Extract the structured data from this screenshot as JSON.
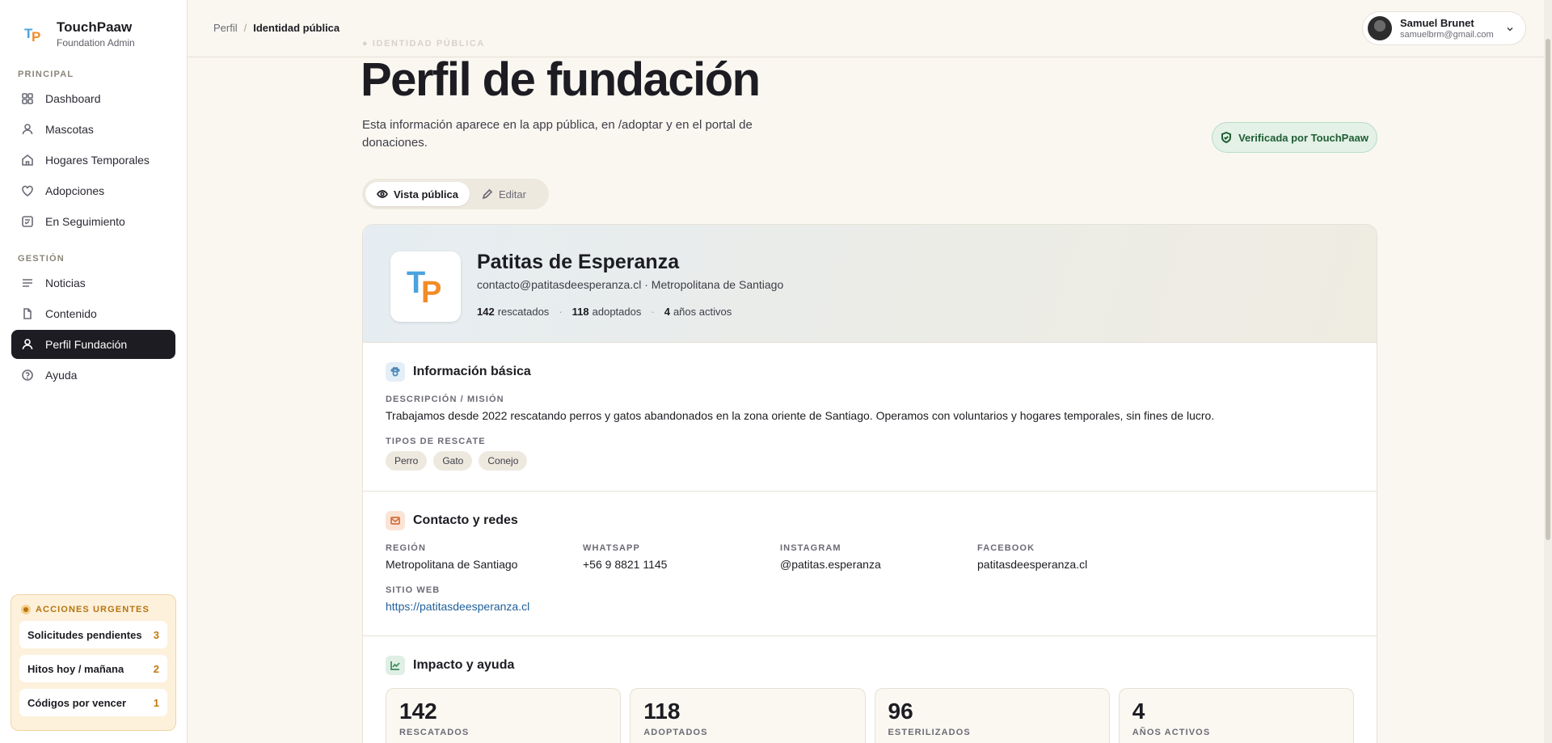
{
  "brand": {
    "name": "TouchPaaw",
    "role": "Foundation Admin"
  },
  "sidebar": {
    "principal_label": "PRINCIPAL",
    "principal_items": [
      {
        "label": "Dashboard",
        "icon": "grid-icon"
      },
      {
        "label": "Mascotas",
        "icon": "user-icon"
      },
      {
        "label": "Hogares Temporales",
        "icon": "home-icon"
      },
      {
        "label": "Adopciones",
        "icon": "heart-icon"
      },
      {
        "label": "En Seguimiento",
        "icon": "checklist-icon"
      }
    ],
    "gestion_label": "GESTIÓN",
    "gestion_items": [
      {
        "label": "Noticias",
        "icon": "lines-icon"
      },
      {
        "label": "Contenido",
        "icon": "file-icon"
      },
      {
        "label": "Perfil Fundación",
        "icon": "user-icon",
        "active": true
      },
      {
        "label": "Ayuda",
        "icon": "help-icon"
      }
    ],
    "urgent": {
      "title": "ACCIONES URGENTES",
      "rows": [
        {
          "label": "Solicitudes pendientes",
          "count": "3"
        },
        {
          "label": "Hitos hoy / mañana",
          "count": "2"
        },
        {
          "label": "Códigos por vencer",
          "count": "1"
        }
      ]
    }
  },
  "header": {
    "breadcrumb": {
      "parent": "Perfil",
      "sep": "/",
      "current": "Identidad pública"
    },
    "user": {
      "name": "Samuel Brunet",
      "email": "samuelbrm@gmail.com"
    }
  },
  "page": {
    "eyebrow": "● IDENTIDAD PÚBLICA",
    "title": "Perfil de fundación",
    "description": "Esta información aparece en la app pública, en /adoptar y en el portal de donaciones.",
    "verified_badge": "Verificada por TouchPaaw",
    "view_toggle": {
      "public": "Vista pública",
      "edit": "Editar"
    }
  },
  "profile": {
    "name": "Patitas de Esperanza",
    "email": "contacto@patitasdeesperanza.cl",
    "dot": "·",
    "region": "Metropolitana de Santiago",
    "stats": [
      {
        "value": "142",
        "label": "rescatados"
      },
      {
        "value": "118",
        "label": "adoptados"
      },
      {
        "value": "4",
        "label": "años activos"
      }
    ]
  },
  "basic": {
    "title": "Información básica",
    "mission_label": "DESCRIPCIÓN / MISIÓN",
    "mission": "Trabajamos desde 2022 rescatando perros y gatos abandonados en la zona oriente de Santiago. Operamos con voluntarios y hogares temporales, sin fines de lucro.",
    "types_label": "TIPOS DE RESCATE",
    "types": [
      "Perro",
      "Gato",
      "Conejo"
    ]
  },
  "contact": {
    "title": "Contacto y redes",
    "fields": [
      {
        "label": "REGIÓN",
        "value": "Metropolitana de Santiago"
      },
      {
        "label": "WHATSAPP",
        "value": "+56 9 8821 1145"
      },
      {
        "label": "INSTAGRAM",
        "value": "@patitas.esperanza"
      },
      {
        "label": "FACEBOOK",
        "value": "patitasdeesperanza.cl"
      }
    ],
    "web_label": "SITIO WEB",
    "web_value": "https://patitasdeesperanza.cl"
  },
  "impact": {
    "title": "Impacto y ayuda",
    "stats": [
      {
        "value": "142",
        "label": "RESCATADOS"
      },
      {
        "value": "118",
        "label": "ADOPTADOS"
      },
      {
        "value": "96",
        "label": "ESTERILIZADOS"
      },
      {
        "value": "4",
        "label": "AÑOS ACTIVOS"
      }
    ]
  }
}
